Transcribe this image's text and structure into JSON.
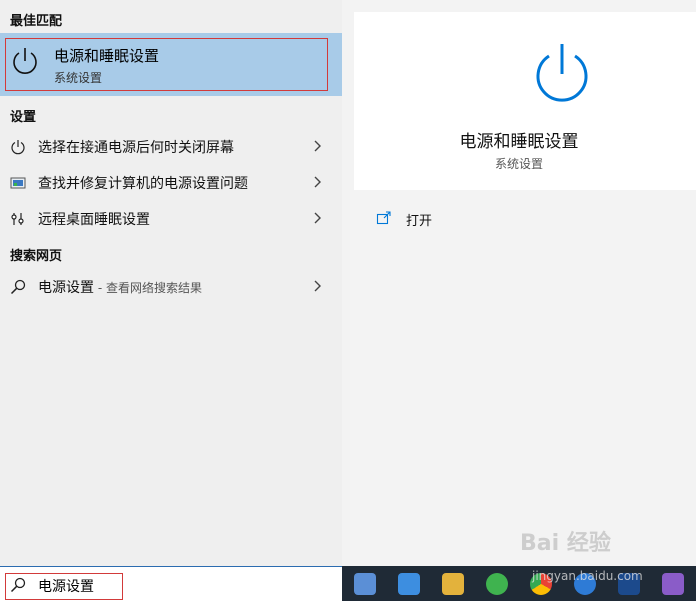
{
  "left_panel": {
    "best_match_header": "最佳匹配",
    "best_match": {
      "title": "电源和睡眠设置",
      "subtitle": "系统设置",
      "icon": "power-icon"
    },
    "settings_header": "设置",
    "settings_items": [
      {
        "label": "选择在接通电源后何时关闭屏幕",
        "icon": "power-icon"
      },
      {
        "label": "查找并修复计算机的电源设置问题",
        "icon": "troubleshoot-icon"
      },
      {
        "label": "远程桌面睡眠设置",
        "icon": "remote-desktop-icon"
      }
    ],
    "web_header": "搜索网页",
    "web_item": {
      "label": "电源设置",
      "suffix": " - 查看网络搜索结果",
      "icon": "search-icon"
    }
  },
  "right_panel": {
    "title": "电源和睡眠设置",
    "subtitle": "系统设置",
    "open_label": "打开"
  },
  "search": {
    "value": "电源设置"
  },
  "watermark": {
    "text": "Bai 经验",
    "url": "jingyan.baidu.com"
  },
  "colors": {
    "accent": "#0078d7",
    "highlight": "#a8cbe8",
    "outline": "#d23a3a"
  }
}
